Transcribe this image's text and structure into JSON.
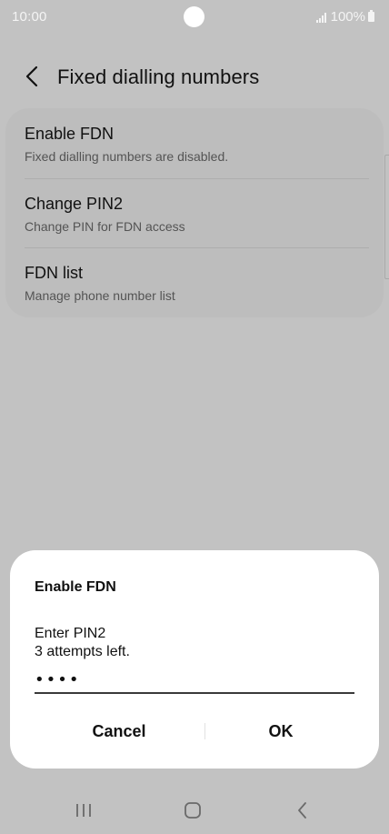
{
  "status_bar": {
    "time": "10:00",
    "battery": "100%",
    "icons": [
      "signal-icon",
      "battery-icon"
    ]
  },
  "header": {
    "title": "Fixed dialling numbers",
    "back_icon": "chevron-left-icon"
  },
  "settings": {
    "items": [
      {
        "title": "Enable FDN",
        "subtitle": "Fixed dialling numbers are disabled."
      },
      {
        "title": "Change PIN2",
        "subtitle": "Change PIN for FDN access"
      },
      {
        "title": "FDN list",
        "subtitle": "Manage phone number list"
      }
    ]
  },
  "dialog": {
    "title": "Enable FDN",
    "message_line1": "Enter PIN2",
    "message_line2": "3 attempts left.",
    "pin_value": "1234",
    "cancel_label": "Cancel",
    "ok_label": "OK"
  },
  "nav_bar": {
    "icons": [
      "recents-icon",
      "home-icon",
      "back-icon"
    ]
  },
  "colors": {
    "background_dimmed": "#c2c2c2",
    "card": "#bdbdbd",
    "dialog": "#ffffff",
    "text_primary": "#111111",
    "text_secondary": "#545454"
  }
}
